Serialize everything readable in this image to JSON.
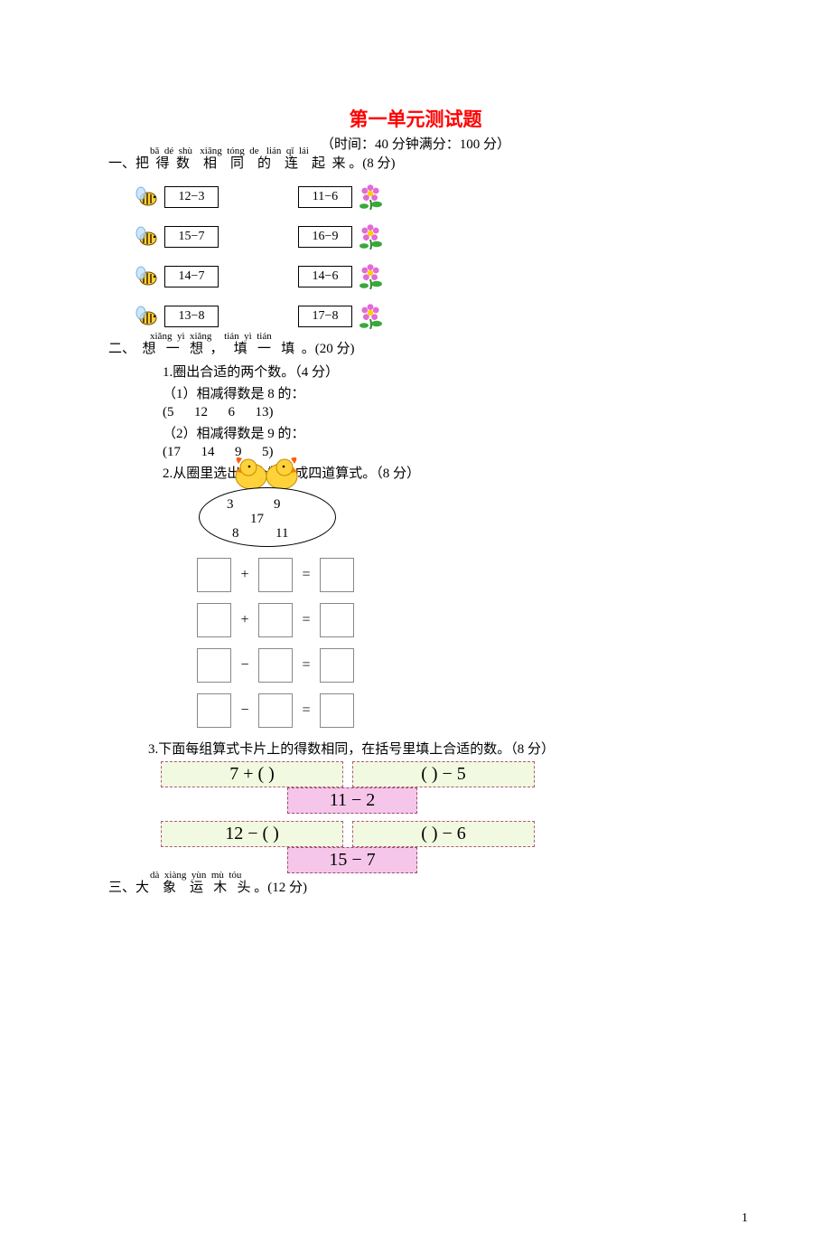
{
  "title": "第一单元测试题",
  "timing": "（时间：40 分钟满分：100 分）",
  "section1": {
    "pinyin": "bǎ  dé  shù   xiāng  tóng  de   lián  qǐ  lái",
    "cn": "一、把  得  数    相    同    的    连    起  来 。(8 分)",
    "left": [
      "12−3",
      "15−7",
      "14−7",
      "13−8"
    ],
    "right": [
      "11−6",
      "16−9",
      "14−6",
      "17−8"
    ]
  },
  "section2": {
    "pinyin": "xiǎng  yì  xiǎng     tián  yì  tián",
    "cn": "二、  想   一   想  ，   填   一   填  。(20 分)",
    "q1_head": "1.圈出合适的两个数。（4 分）",
    "q1_a": "（1）相减得数是 8 的：",
    "q1_a_opts": "(5      12      6      13)",
    "q1_b": "（2）相减得数是 9 的：",
    "q1_b_opts": "(17      14      9      5)",
    "q2_head": "2.从圈里选出三个数组成四道算式。（8 分）",
    "oval_nums": {
      "a": "3",
      "b": "9",
      "c": "17",
      "d": "8",
      "e": "11"
    },
    "eq_ops": [
      "+",
      "+",
      "−",
      "−"
    ],
    "q3_head": "3.下面每组算式卡片上的得数相同，在括号里填上合适的数。（8 分）",
    "cards1": [
      "7 + (            )",
      "(            ) − 5"
    ],
    "mid1": "11 − 2",
    "cards2": [
      "12 − (            )",
      "(            ) − 6"
    ],
    "mid2": "15 − 7"
  },
  "section3": {
    "pinyin": "dà  xiàng  yùn  mù  tóu",
    "cn": "三、大    象    运   木   头 。(12 分)"
  },
  "page_number": "1"
}
